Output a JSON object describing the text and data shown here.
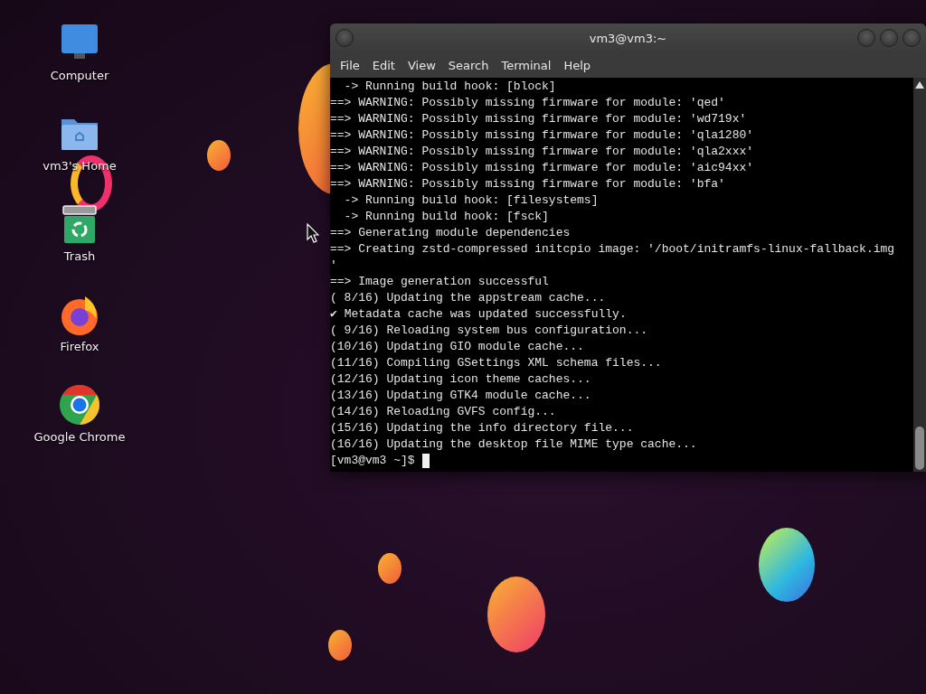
{
  "desktop_icons": [
    {
      "kind": "computer",
      "label": "Computer"
    },
    {
      "kind": "home",
      "label": "vm3's Home"
    },
    {
      "kind": "trash",
      "label": "Trash"
    },
    {
      "kind": "firefox",
      "label": "Firefox"
    },
    {
      "kind": "chrome",
      "label": "Google Chrome"
    }
  ],
  "terminal": {
    "title": "vm3@vm3:~",
    "menu": [
      "File",
      "Edit",
      "View",
      "Search",
      "Terminal",
      "Help"
    ],
    "lines": [
      "  -> Running build hook: [block]",
      "==> WARNING: Possibly missing firmware for module: 'qed'",
      "==> WARNING: Possibly missing firmware for module: 'wd719x'",
      "==> WARNING: Possibly missing firmware for module: 'qla1280'",
      "==> WARNING: Possibly missing firmware for module: 'qla2xxx'",
      "==> WARNING: Possibly missing firmware for module: 'aic94xx'",
      "==> WARNING: Possibly missing firmware for module: 'bfa'",
      "  -> Running build hook: [filesystems]",
      "  -> Running build hook: [fsck]",
      "==> Generating module dependencies",
      "==> Creating zstd-compressed initcpio image: '/boot/initramfs-linux-fallback.img",
      "'",
      "==> Image generation successful",
      "( 8/16) Updating the appstream cache...",
      "✔ Metadata cache was updated successfully.",
      "( 9/16) Reloading system bus configuration...",
      "(10/16) Updating GIO module cache...",
      "(11/16) Compiling GSettings XML schema files...",
      "(12/16) Updating icon theme caches...",
      "(13/16) Updating GTK4 module cache...",
      "(14/16) Reloading GVFS config...",
      "(15/16) Updating the info directory file...",
      "(16/16) Updating the desktop file MIME type cache..."
    ],
    "prompt": "[vm3@vm3 ~]$"
  }
}
